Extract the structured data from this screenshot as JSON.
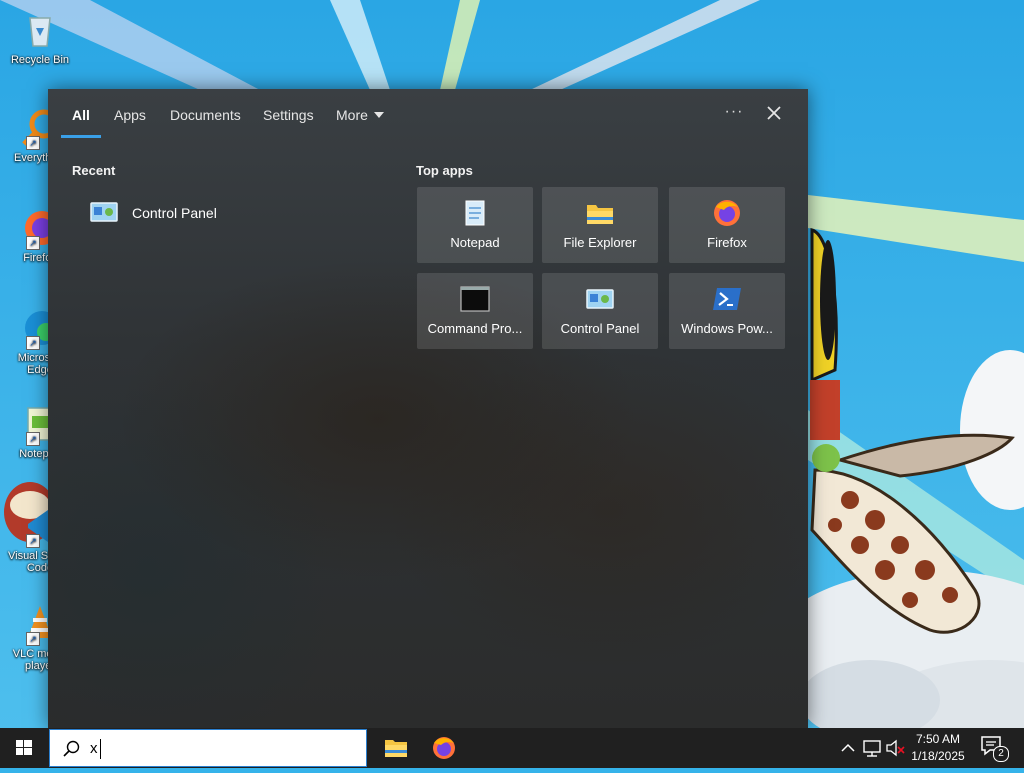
{
  "desktop": {
    "icons": [
      {
        "label": "Recycle Bin"
      },
      {
        "label": "Everything"
      },
      {
        "label": "Firefox"
      },
      {
        "label": "Microsoft Edge"
      },
      {
        "label": "Notepad"
      },
      {
        "label": "Visual Studio Code"
      },
      {
        "label": "VLC media player"
      }
    ]
  },
  "panel": {
    "tabs": [
      "All",
      "Apps",
      "Documents",
      "Settings",
      "More"
    ],
    "active_tab": "All",
    "ellipsis": "···",
    "recent": {
      "title": "Recent",
      "items": [
        {
          "label": "Control Panel",
          "icon": "control-panel-icon"
        }
      ]
    },
    "top_apps": {
      "title": "Top apps",
      "tiles": [
        {
          "label": "Notepad",
          "icon": "notepad-icon"
        },
        {
          "label": "File Explorer",
          "icon": "file-explorer-icon"
        },
        {
          "label": "Firefox",
          "icon": "firefox-icon"
        },
        {
          "label": "Command Pro...",
          "icon": "command-prompt-icon"
        },
        {
          "label": "Control Panel",
          "icon": "control-panel-icon"
        },
        {
          "label": "Windows Pow...",
          "icon": "powershell-icon"
        }
      ]
    }
  },
  "taskbar": {
    "search_value": "x",
    "pinned": [
      {
        "icon": "file-explorer-icon"
      },
      {
        "icon": "firefox-icon"
      }
    ],
    "clock": {
      "time": "7:50 AM",
      "date": "1/18/2025"
    },
    "notification_count": "2"
  },
  "colors": {
    "accent": "#3aa0e8",
    "panel_bg": "#2f3336",
    "taskbar_bg": "#202020",
    "sky": "#35b3ea"
  }
}
